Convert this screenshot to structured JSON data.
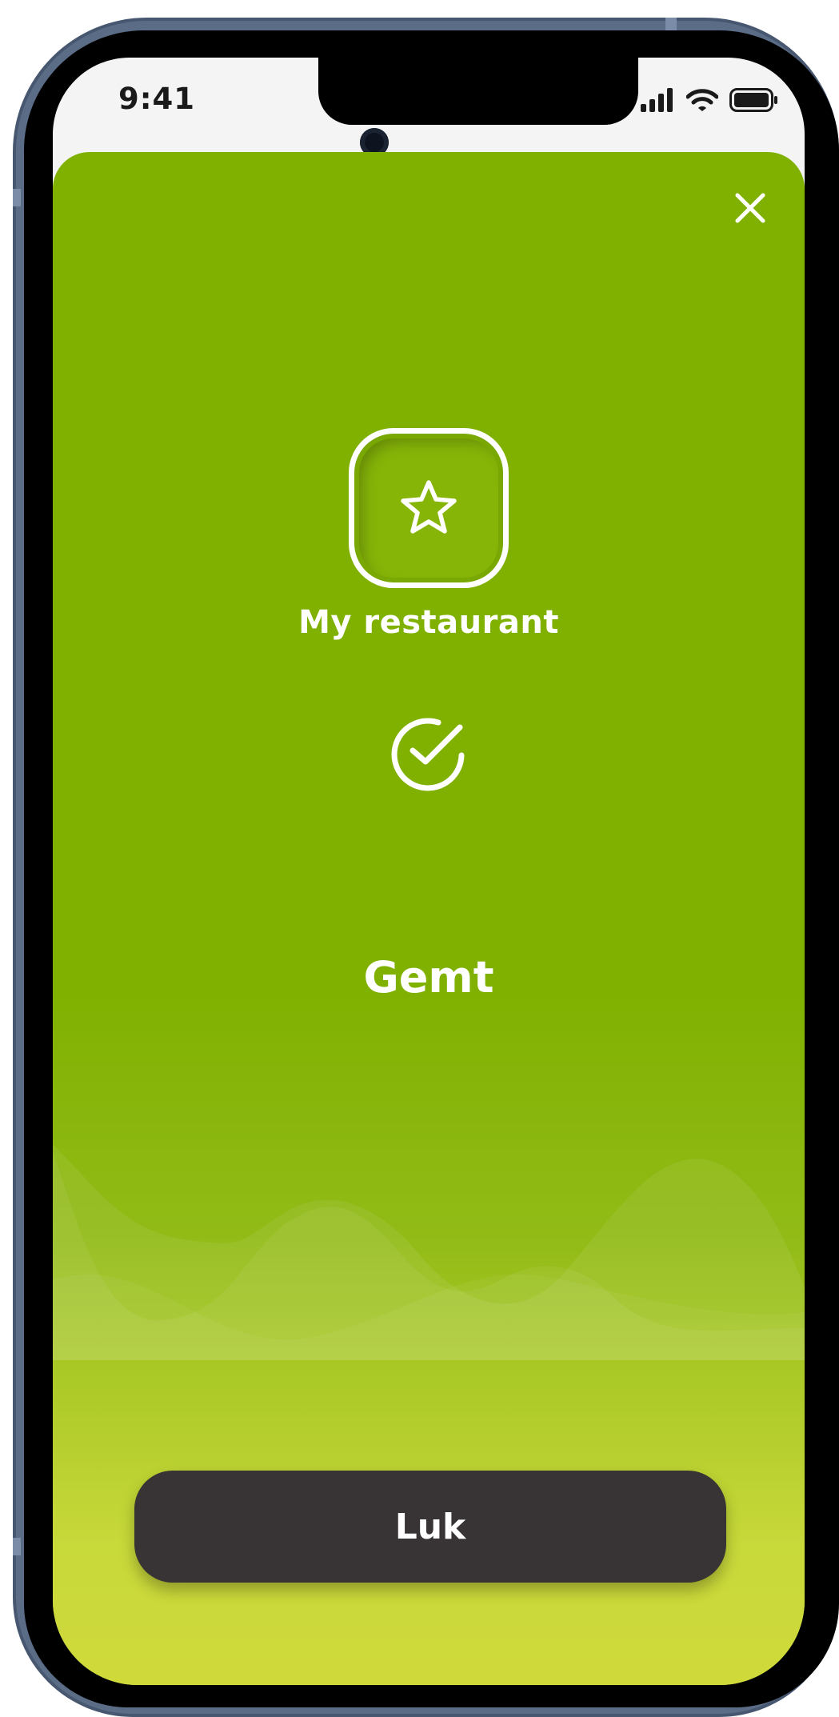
{
  "status_bar": {
    "time": "9:41",
    "icons": [
      "cellular-signal-icon",
      "wifi-icon",
      "battery-icon"
    ]
  },
  "modal": {
    "close_icon": "close-icon",
    "item_icon": "star-icon",
    "item_label": "My restaurant",
    "confirmation_icon": "check-circle-icon",
    "confirmation_text": "Gemt",
    "close_button_label": "Luk"
  },
  "colors": {
    "sheet_background": "#80b101",
    "sheet_gradient_bottom": "#d0d93a",
    "button_background": "#383334",
    "text": "#ffffff",
    "device_frame": "#46576f"
  }
}
